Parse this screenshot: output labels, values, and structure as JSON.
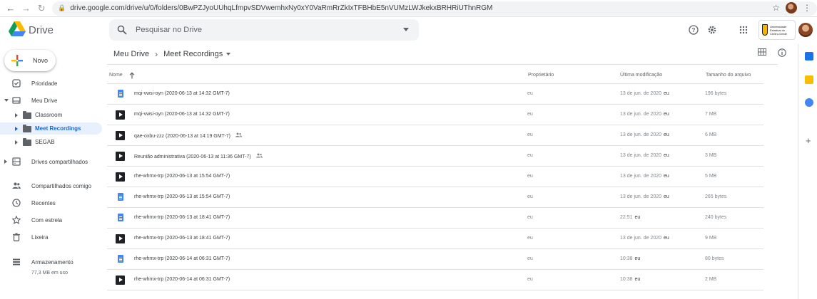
{
  "browser": {
    "url": "drive.google.com/drive/u/0/folders/0BwPZJyoUUhqLfmpvSDVwemhxNy0xY0VaRmRrZkIxTFBHbE5nVUMzLWJkekxBRHRiUThnRGM"
  },
  "app": {
    "name": "Drive",
    "search_placeholder": "Pesquisar no Drive",
    "org_badge": "Universidade Estadual do Centro-Oeste"
  },
  "sidebar": {
    "new_label": "Novo",
    "items": [
      {
        "label": "Prioridade",
        "icon": "check-square-icon"
      },
      {
        "label": "Meu Drive",
        "icon": "my-drive-icon"
      },
      {
        "label": "Drives compartilhados",
        "icon": "shared-drives-icon"
      },
      {
        "label": "Compartilhados comigo",
        "icon": "people-icon"
      },
      {
        "label": "Recentes",
        "icon": "clock-icon"
      },
      {
        "label": "Com estrela",
        "icon": "star-icon"
      },
      {
        "label": "Lixeira",
        "icon": "trash-icon"
      },
      {
        "label": "Armazenamento",
        "icon": "storage-icon"
      }
    ],
    "folders": [
      {
        "label": "Classroom"
      },
      {
        "label": "Meet Recordings"
      },
      {
        "label": "SEGAB"
      }
    ],
    "storage_used": "77,3 MB em uso"
  },
  "breadcrumb": {
    "root": "Meu Drive",
    "current": "Meet Recordings"
  },
  "table": {
    "headers": {
      "name": "Nome",
      "owner": "Proprietário",
      "modified": "Última modificação",
      "size": "Tamanho do arquivo"
    },
    "rows": [
      {
        "type": "doc",
        "name": "mqi-vwsi-oyn (2020-06-13 at 14:32 GMT-7)",
        "shared": false,
        "owner": "eu",
        "modified": "13 de jun. de 2020",
        "modified_by": "eu",
        "size": "196 bytes"
      },
      {
        "type": "video",
        "name": "mqi-vwsi-oyn (2020-06-13 at 14:32 GMT-7)",
        "shared": false,
        "owner": "eu",
        "modified": "13 de jun. de 2020",
        "modified_by": "eu",
        "size": "7 MB"
      },
      {
        "type": "video",
        "name": "qae-oxbu-zzz (2020-06-13 at 14:19 GMT-7)",
        "shared": true,
        "owner": "eu",
        "modified": "13 de jun. de 2020",
        "modified_by": "eu",
        "size": "6 MB"
      },
      {
        "type": "video",
        "name": "Reunião administrativa (2020-06-13 at 11:36 GMT-7)",
        "shared": true,
        "owner": "eu",
        "modified": "13 de jun. de 2020",
        "modified_by": "eu",
        "size": "3 MB"
      },
      {
        "type": "video",
        "name": "rhe-whmx-trp (2020-06-13 at 15:54 GMT-7)",
        "shared": false,
        "owner": "eu",
        "modified": "13 de jun. de 2020",
        "modified_by": "eu",
        "size": "5 MB"
      },
      {
        "type": "doc",
        "name": "rhe-whmx-trp (2020-06-13 at 15:54 GMT-7)",
        "shared": false,
        "owner": "eu",
        "modified": "13 de jun. de 2020",
        "modified_by": "eu",
        "size": "265 bytes"
      },
      {
        "type": "doc",
        "name": "rhe-whmx-trp (2020-06-13 at 18:41 GMT-7)",
        "shared": false,
        "owner": "eu",
        "modified": "22:51",
        "modified_by": "eu",
        "size": "240 bytes"
      },
      {
        "type": "video",
        "name": "rhe-whmx-trp (2020-06-13 at 18:41 GMT-7)",
        "shared": false,
        "owner": "eu",
        "modified": "13 de jun. de 2020",
        "modified_by": "eu",
        "size": "9 MB"
      },
      {
        "type": "doc",
        "name": "rhe-whmx-trp (2020-06-14 at 06:31 GMT-7)",
        "shared": false,
        "owner": "eu",
        "modified": "10:38",
        "modified_by": "eu",
        "size": "80 bytes"
      },
      {
        "type": "video",
        "name": "rhe-whmx-trp (2020-06-14 at 06:31 GMT-7)",
        "shared": false,
        "owner": "eu",
        "modified": "10:38",
        "modified_by": "eu",
        "size": "2 MB"
      }
    ]
  },
  "colors": {
    "accent": "#1967d2",
    "active_bg": "#e8f0fe",
    "doc_blue": "#4285f4"
  }
}
